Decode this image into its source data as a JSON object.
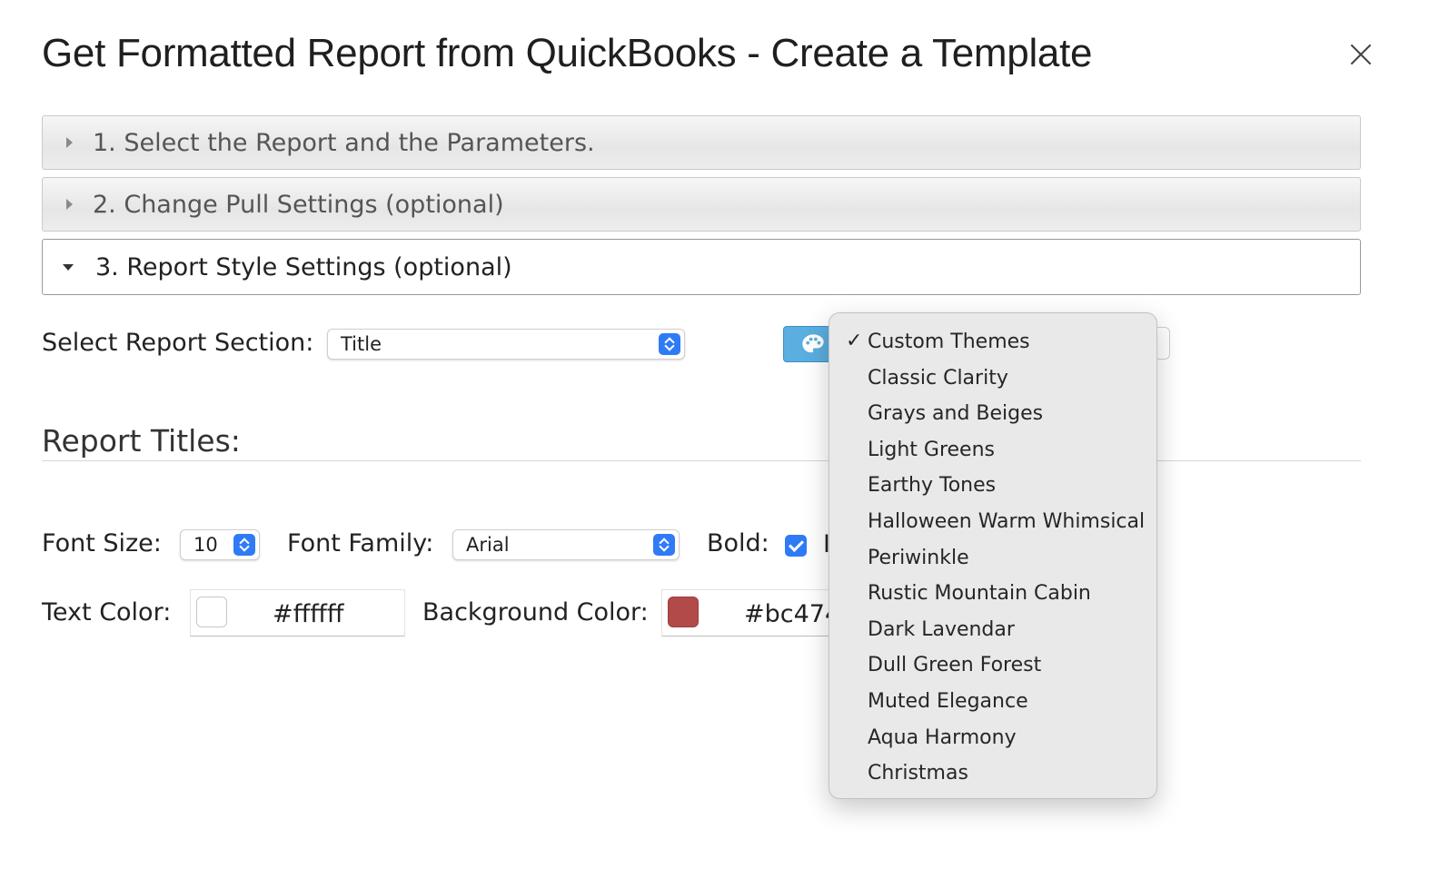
{
  "dialog": {
    "title": "Get Formatted Report from QuickBooks - Create a Template"
  },
  "accordion": [
    {
      "label": "1. Select the Report and the Parameters.",
      "expanded": false
    },
    {
      "label": "2. Change Pull Settings (optional)",
      "expanded": false
    },
    {
      "label": "3. Report Style Settings (optional)",
      "expanded": true
    }
  ],
  "style_settings": {
    "section_label": "Select Report Section:",
    "section_value": "Title",
    "theme_button_icon": "palette-icon",
    "heading": "Report Titles:",
    "font_size_label": "Font Size:",
    "font_size_value": "10",
    "font_family_label": "Font Family:",
    "font_family_value": "Arial",
    "bold_label": "Bold:",
    "bold_checked": true,
    "partial_next_label": "I",
    "text_color_label": "Text Color:",
    "text_color_value": "#ffffff",
    "text_color_swatch": "#ffffff",
    "background_color_label": "Background Color:",
    "background_color_value": "#bc474",
    "background_color_swatch": "#b24a4a"
  },
  "theme_menu": {
    "items": [
      {
        "label": "Custom Themes",
        "checked": true
      },
      {
        "label": "Classic Clarity",
        "checked": false
      },
      {
        "label": "Grays and Beiges",
        "checked": false
      },
      {
        "label": "Light Greens",
        "checked": false
      },
      {
        "label": "Earthy Tones",
        "checked": false
      },
      {
        "label": "Halloween Warm Whimsical",
        "checked": false
      },
      {
        "label": "Periwinkle",
        "checked": false
      },
      {
        "label": "Rustic Mountain Cabin",
        "checked": false
      },
      {
        "label": "Dark Lavendar",
        "checked": false
      },
      {
        "label": "Dull Green Forest",
        "checked": false
      },
      {
        "label": "Muted Elegance",
        "checked": false
      },
      {
        "label": "Aqua Harmony",
        "checked": false
      },
      {
        "label": "Christmas",
        "checked": false
      }
    ],
    "check_glyph": "✓"
  },
  "colors": {
    "accent": "#2f7bf6",
    "theme_button": "#5aaee0"
  }
}
